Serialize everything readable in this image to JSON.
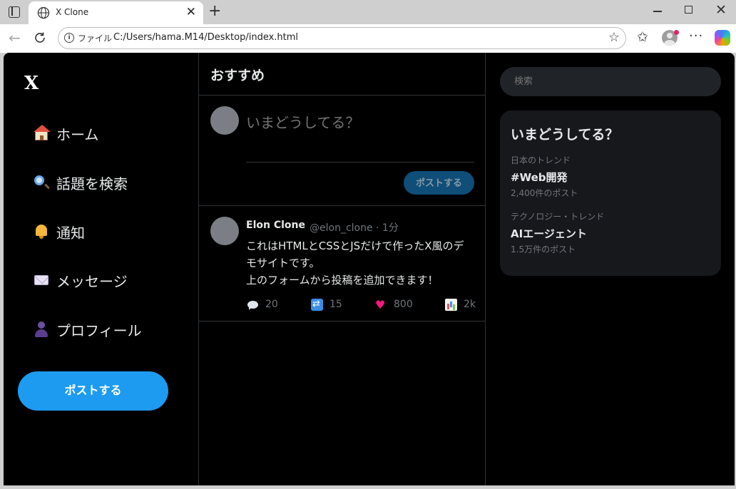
{
  "browser": {
    "tab_title": "X Clone",
    "address_scheme": "ファイル",
    "address_url": "C:/Users/hama.M14/Desktop/index.html"
  },
  "sidebar": {
    "logo": "X",
    "items": [
      {
        "icon": "house-icon",
        "label": "ホーム"
      },
      {
        "icon": "magnifier-icon",
        "label": "話題を検索"
      },
      {
        "icon": "bell-icon",
        "label": "通知"
      },
      {
        "icon": "envelope-icon",
        "label": "メッセージ"
      },
      {
        "icon": "user-icon",
        "label": "プロフィール"
      }
    ],
    "post_button": "ポストする"
  },
  "feed": {
    "title": "おすすめ",
    "compose": {
      "placeholder": "いまどうしてる？",
      "button": "ポストする"
    },
    "post": {
      "name": "Elon Clone",
      "handle_time": "@elon_clone · 1分",
      "body_lines": [
        "これはHTMLとCSSとJSだけで作ったX風のデ",
        "モサイトです。",
        "上のフォームから投稿を追加できます！"
      ],
      "actions": [
        {
          "icon": "reply-icon",
          "value": "20"
        },
        {
          "icon": "retweet-icon",
          "value": "15"
        },
        {
          "icon": "heart-icon",
          "value": "800"
        },
        {
          "icon": "stats-icon",
          "value": "2k"
        }
      ]
    }
  },
  "right": {
    "search_placeholder": "検索",
    "trends_title": "いまどうしてる？",
    "trends": [
      {
        "category": "日本のトレンド",
        "name": "#Web開発",
        "count": "2,400件のポスト"
      },
      {
        "category": "テクノロジー・トレンド",
        "name": "AIエージェント",
        "count": "1.5万件のポスト"
      }
    ]
  },
  "colors": {
    "accent": "#1d9bf0",
    "background": "#000000",
    "card": "#16181c",
    "muted_text": "#71767b"
  }
}
